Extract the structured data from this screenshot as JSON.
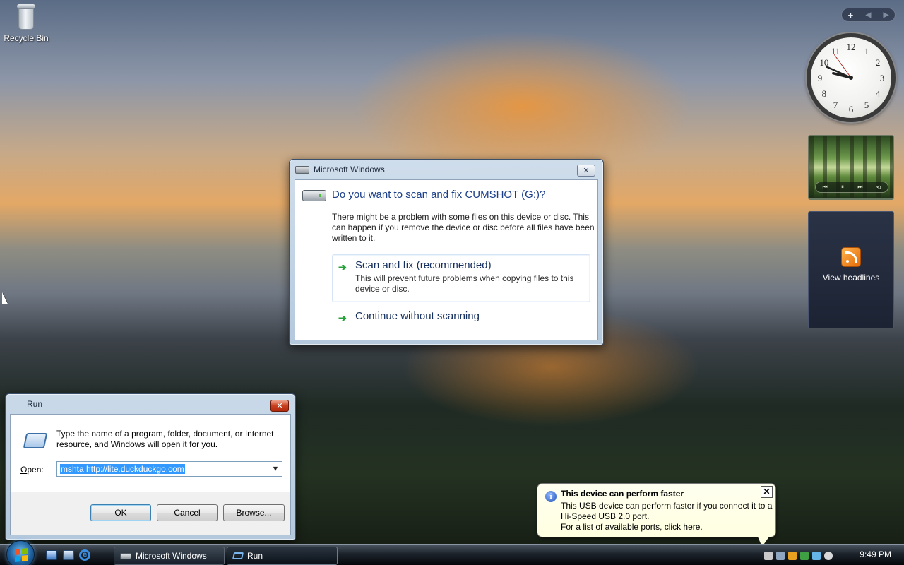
{
  "desktop": {
    "icons": [
      {
        "label": "Recycle Bin",
        "icon": "recycle-bin-icon"
      }
    ]
  },
  "sidebar": {
    "controls": {
      "add": "+",
      "prev": "◀",
      "next": "▶"
    },
    "clock": {
      "numbers": [
        "12",
        "1",
        "2",
        "3",
        "4",
        "5",
        "6",
        "7",
        "8",
        "9",
        "10",
        "11"
      ],
      "hour_angle_deg": 284,
      "minute_angle_deg": 294,
      "second_angle_deg": 324
    },
    "feed": {
      "label": "View headlines",
      "icon": "rss-icon"
    },
    "media": {
      "controls": [
        "⏮",
        "⏸",
        "⏭",
        "⟲"
      ]
    }
  },
  "scan_dialog": {
    "title": "Microsoft Windows",
    "close": "✕",
    "heading": "Do you want to scan and fix CUMSHOT (G:)?",
    "body": "There might be a problem with some files on this device or disc. This can happen if you remove the device or disc before all files have been written to it.",
    "options": [
      {
        "title": "Scan and fix (recommended)",
        "subtitle": "This will prevent future problems when copying files to this device or disc."
      },
      {
        "title": "Continue without scanning",
        "subtitle": ""
      }
    ],
    "arrow": "➔"
  },
  "run_dialog": {
    "title": "Run",
    "close": "✕",
    "description": "Type the name of a program, folder, document, or Internet resource, and Windows will open it for you.",
    "open_label_accel": "O",
    "open_label_rest": "pen:",
    "open_value": "mshta http://lite.duckduckgo.com",
    "dropdown_arrow": "▼",
    "buttons": {
      "ok": "OK",
      "cancel": "Cancel",
      "browse": "Browse..."
    }
  },
  "balloon": {
    "title": "This device can perform faster",
    "lines": [
      "This USB device can perform faster if you connect it to a",
      "Hi-Speed USB 2.0 port.",
      "For a list of available ports, click here."
    ],
    "close": "✕",
    "icon": "i"
  },
  "taskbar": {
    "buttons": [
      {
        "label": "Microsoft Windows"
      },
      {
        "label": "Run"
      }
    ],
    "ie_glyph": "e",
    "time": "9:49 PM"
  },
  "colors": {
    "accent": "#1a3e8a",
    "link_arrow": "#27a23a",
    "selection": "#3399ff",
    "balloon_bg": "#ffffe1"
  }
}
